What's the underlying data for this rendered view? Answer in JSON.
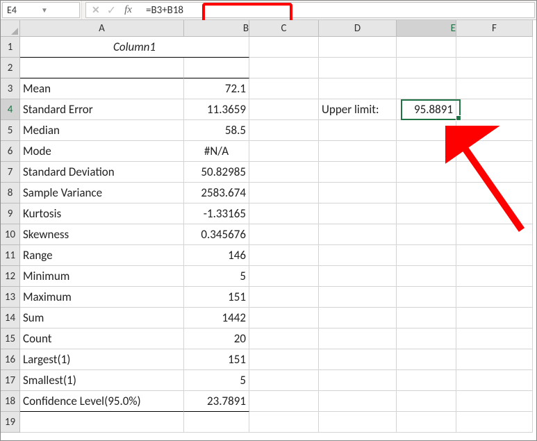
{
  "nameBox": "E4",
  "formula": "=B3+B18",
  "fx_label": "fx",
  "columns": [
    "A",
    "B",
    "C",
    "D",
    "E",
    "F"
  ],
  "rowCount": 19,
  "header": {
    "merged": "Column1"
  },
  "data": {
    "r3": {
      "A": "Mean",
      "B": "72.1"
    },
    "r4": {
      "A": "Standard Error",
      "B": "11.3659",
      "D": "Upper limit:",
      "E": "95.8891"
    },
    "r5": {
      "A": "Median",
      "B": "58.5"
    },
    "r6": {
      "A": "Mode",
      "B": "#N/A"
    },
    "r7": {
      "A": "Standard Deviation",
      "B": "50.82985"
    },
    "r8": {
      "A": "Sample Variance",
      "B": "2583.674"
    },
    "r9": {
      "A": "Kurtosis",
      "B": "-1.33165"
    },
    "r10": {
      "A": "Skewness",
      "B": "0.345676"
    },
    "r11": {
      "A": "Range",
      "B": "146"
    },
    "r12": {
      "A": "Minimum",
      "B": "5"
    },
    "r13": {
      "A": "Maximum",
      "B": "151"
    },
    "r14": {
      "A": "Sum",
      "B": "1442"
    },
    "r15": {
      "A": "Count",
      "B": "20"
    },
    "r16": {
      "A": "Largest(1)",
      "B": "151"
    },
    "r17": {
      "A": "Smallest(1)",
      "B": "5"
    },
    "r18": {
      "A": "Confidence Level(95.0%)",
      "B": "23.7891"
    }
  },
  "activeCell": {
    "row": 4,
    "col": "E"
  },
  "annotations": {
    "highlight_formula": true,
    "arrow_to_E4": true,
    "arrow_color": "#FF0000"
  }
}
